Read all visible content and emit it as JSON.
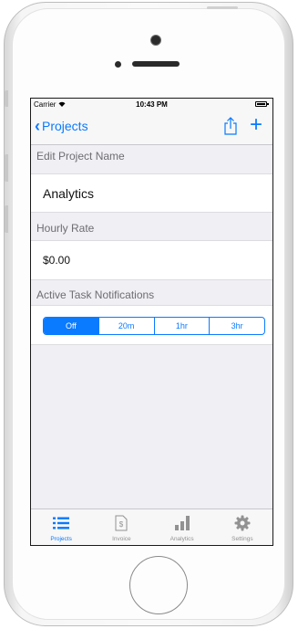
{
  "status_bar": {
    "carrier": "Carrier",
    "time": "10:43 PM"
  },
  "nav": {
    "back_label": "Projects",
    "share_icon": "share-icon",
    "add_icon": "plus-icon",
    "add_glyph": "+"
  },
  "sections": {
    "name_header": "Edit Project Name",
    "name_value": "Analytics",
    "rate_header": "Hourly Rate",
    "rate_value": "$0.00",
    "notifications_header": "Active Task Notifications"
  },
  "notifications": {
    "options": [
      "Off",
      "20m",
      "1hr",
      "3hr"
    ],
    "selected": "Off"
  },
  "tabbar": {
    "items": [
      {
        "label": "Projects",
        "icon": "list-icon",
        "active": true
      },
      {
        "label": "Invoice",
        "icon": "invoice-icon",
        "active": false
      },
      {
        "label": "Analytics",
        "icon": "bar-chart-icon",
        "active": false
      },
      {
        "label": "Settings",
        "icon": "gear-icon",
        "active": false
      }
    ]
  },
  "colors": {
    "accent": "#0a7aff",
    "background": "#efeff4",
    "inactive": "#929292"
  }
}
